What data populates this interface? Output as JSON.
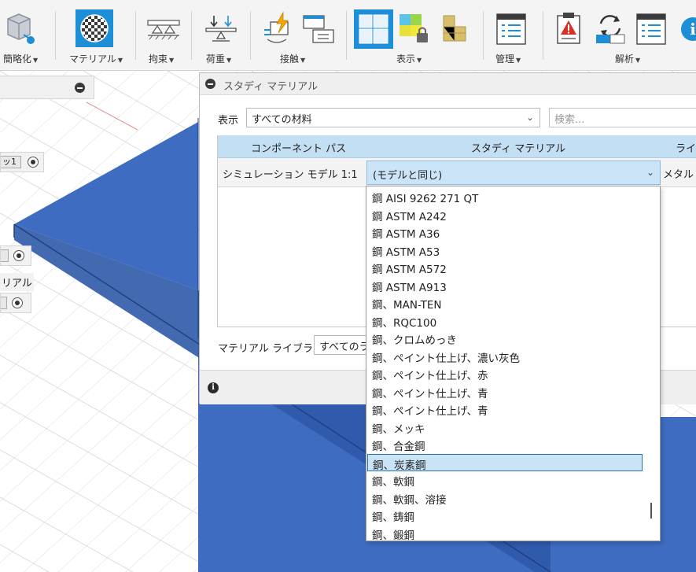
{
  "toolbar": {
    "groups": [
      {
        "label": "簡略化"
      },
      {
        "label": "マテリアル"
      },
      {
        "label": "拘束"
      },
      {
        "label": "荷重"
      },
      {
        "label": "接触"
      },
      {
        "label": "表示"
      },
      {
        "label": "管理"
      },
      {
        "label": "解析"
      }
    ]
  },
  "left_panel": {
    "tag_1": "ッ1",
    "tag_2": "リアル"
  },
  "dialog": {
    "title": "スタディ マテリアル",
    "filter_label": "表示",
    "filter_value": "すべての材料",
    "search_placeholder": "検索...",
    "table": {
      "headers": [
        "コンポーネント パス",
        "スタディ マテリアル",
        "ライブ"
      ],
      "row": {
        "component": "シミュレーション モデル 1:1",
        "material": "(モデルと同じ)",
        "library": "メタル"
      }
    },
    "library_label": "マテリアル ライブラリ",
    "library_value": "すべてのライ"
  },
  "dropdown": {
    "items": [
      "鋼 AISI 9262 271 QT",
      "鋼 ASTM A242",
      "鋼 ASTM A36",
      "鋼 ASTM A53",
      "鋼 ASTM A572",
      "鋼 ASTM A913",
      "鋼、MAN-TEN",
      "鋼、RQC100",
      "鋼、クロムめっき",
      "鋼、ペイント仕上げ、濃い灰色",
      "鋼、ペイント仕上げ、赤",
      "鋼、ペイント仕上げ、青",
      "鋼、ペイント仕上げ、青",
      "鋼、メッキ",
      "鋼、合金鋼",
      "鋼、炭素鋼",
      "鋼、軟鋼",
      "鋼、軟鋼、溶接",
      "鋼、鋳鋼",
      "鋼、鍛鋼"
    ],
    "selected_index": 15
  },
  "colors": {
    "accent": "#1e8fd6",
    "header_blue": "#c3dff3",
    "model_blue": "#3d6cc1"
  }
}
